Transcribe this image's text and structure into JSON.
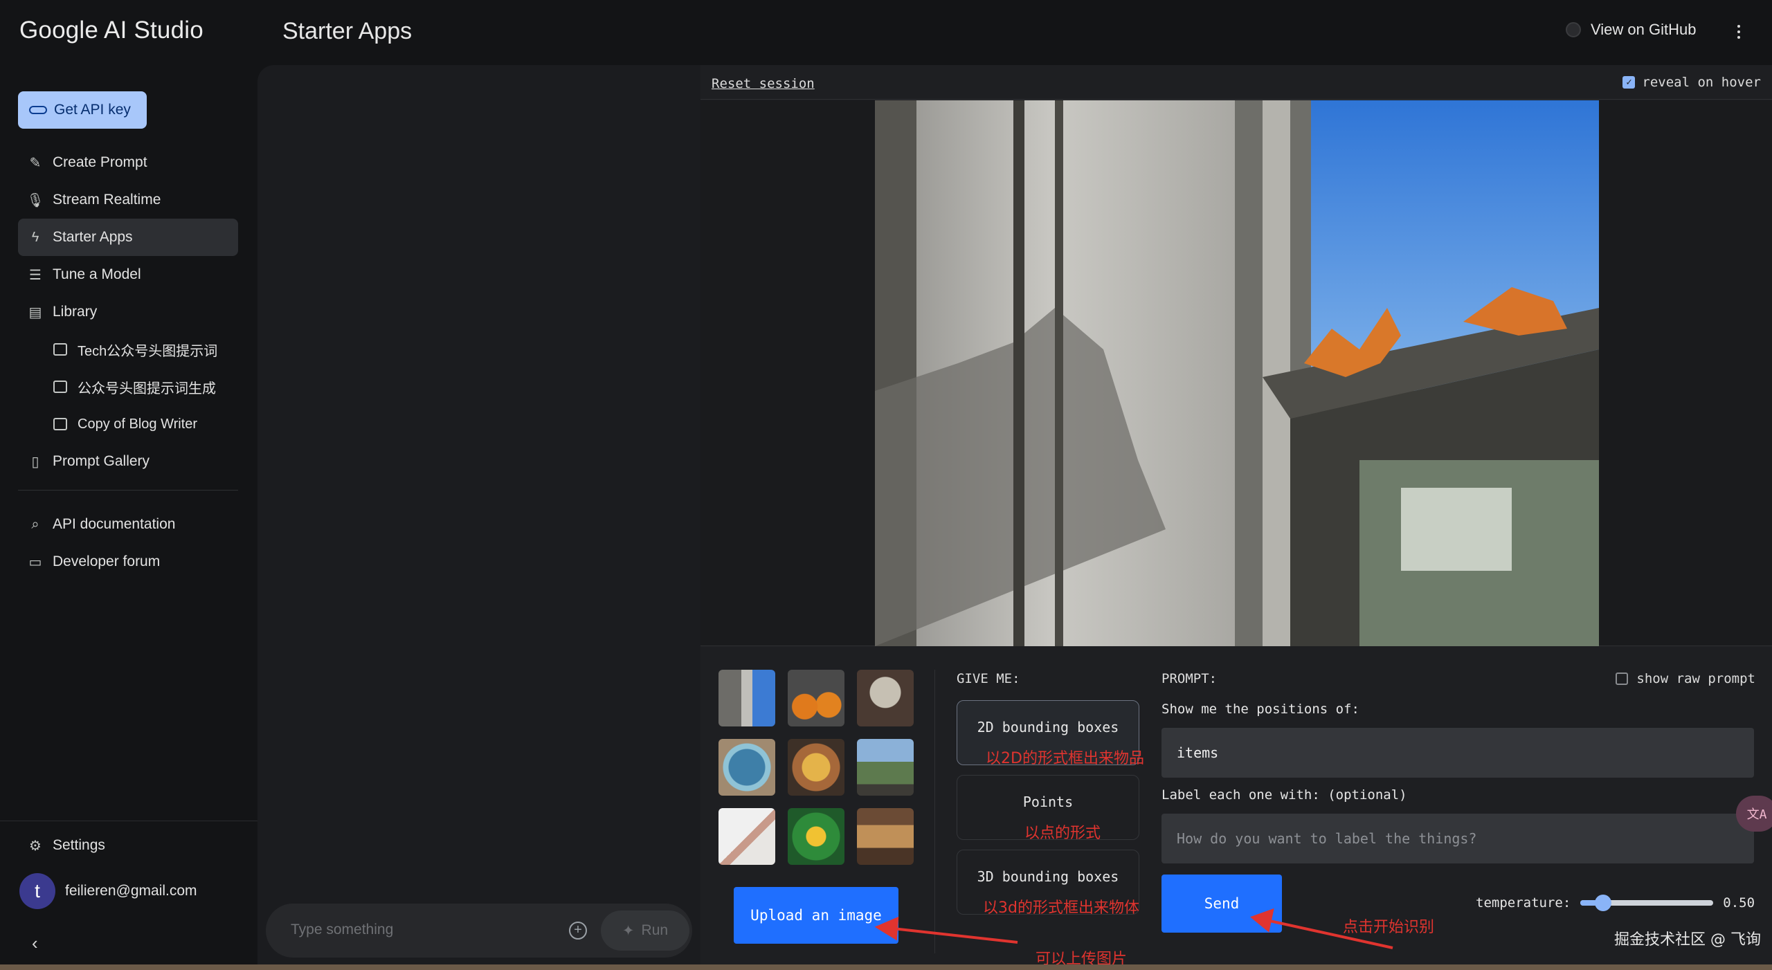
{
  "app": {
    "brand": "Google AI Studio",
    "page_title": "Starter Apps",
    "github_label": "View on GitHub"
  },
  "sidebar": {
    "api_key_label": "Get API key",
    "items": [
      {
        "label": "Create Prompt",
        "icon": "create-prompt-icon"
      },
      {
        "label": "Stream Realtime",
        "icon": "microphone-icon"
      },
      {
        "label": "Starter Apps",
        "icon": "bolt-icon",
        "active": true
      },
      {
        "label": "Tune a Model",
        "icon": "sliders-icon"
      },
      {
        "label": "Library",
        "icon": "library-icon"
      }
    ],
    "library_items": [
      {
        "label": "Tech公众号头图提示词"
      },
      {
        "label": "公众号头图提示词生成"
      },
      {
        "label": "Copy of Blog Writer"
      }
    ],
    "gallery_label": "Prompt Gallery",
    "api_docs_label": "API documentation",
    "forum_label": "Developer forum",
    "settings_label": "Settings",
    "user_initial": "t",
    "user_email": "feilieren@gmail.com"
  },
  "chat": {
    "placeholder": "Type something",
    "run_label": "Run"
  },
  "spatial": {
    "reset_label": "Reset session",
    "reveal_label": "reveal on hover",
    "reveal_checked": true,
    "give_me_label": "GIVE ME:",
    "modes": [
      "2D bounding boxes",
      "Points",
      "3D bounding boxes"
    ],
    "selected_mode": "2D bounding boxes",
    "prompt_label": "PROMPT:",
    "raw_prompt_label": "show raw prompt",
    "raw_prompt_checked": false,
    "show_positions_label": "Show me the positions of:",
    "items_value": "items",
    "label_with_label": "Label each one with: (optional)",
    "label_placeholder": "How do you want to label the things?",
    "upload_label": "Upload an image",
    "send_label": "Send",
    "temperature_label": "temperature:",
    "temperature_value": "0.50",
    "temperature_fraction": 0.17
  },
  "annotations": {
    "mode_2d": "以2D的形式框出来物品",
    "mode_points": "以点的形式",
    "mode_3d": "以3d的形式框出来物体",
    "upload": "可以上传图片",
    "send": "点击开始识别"
  },
  "watermark": "掘金技术社区 @ 飞询",
  "colors": {
    "accent": "#1f6fff",
    "api_button": "#a8c7fa",
    "annotation": "#e0342f"
  }
}
